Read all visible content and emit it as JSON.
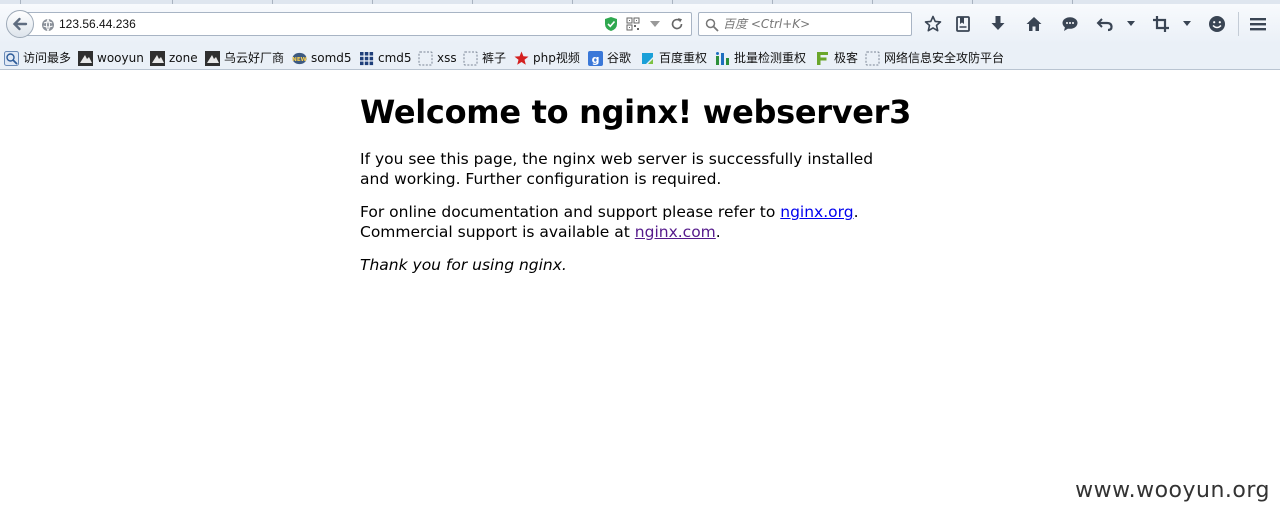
{
  "browser": {
    "url": "123.56.44.236",
    "search_placeholder": "百度 <Ctrl+K>",
    "bookmarks": [
      {
        "label": "访问最多",
        "icon": "most-visited-icon"
      },
      {
        "label": "wooyun",
        "icon": "wooyun-icon"
      },
      {
        "label": "zone",
        "icon": "zone-icon"
      },
      {
        "label": "乌云好厂商",
        "icon": "wooyun-vendor-icon"
      },
      {
        "label": "somd5",
        "icon": "somd5-icon"
      },
      {
        "label": "cmd5",
        "icon": "cmd5-icon"
      },
      {
        "label": "xss",
        "icon": "blank-page-icon"
      },
      {
        "label": "裤子",
        "icon": "blank-page-icon"
      },
      {
        "label": "php视频",
        "icon": "red-star-icon"
      },
      {
        "label": "谷歌",
        "icon": "google-icon"
      },
      {
        "label": "百度重权",
        "icon": "baidu-weight-icon"
      },
      {
        "label": "批量检测重权",
        "icon": "batch-check-icon"
      },
      {
        "label": "极客",
        "icon": "geek-icon"
      },
      {
        "label": "网络信息安全攻防平台",
        "icon": "blank-page-icon"
      }
    ]
  },
  "page": {
    "heading": "Welcome to nginx! webserver3",
    "para1": "If you see this page, the nginx web server is successfully installed and working. Further configuration is required.",
    "para2_prefix": "For online documentation and support please refer to ",
    "link_org": "nginx.org",
    "para2_mid": ".",
    "para2_line2_prefix": "Commercial support is available at ",
    "link_com": "nginx.com",
    "para2_suffix": ".",
    "thanks": "Thank you for using nginx."
  },
  "watermark": "www.wooyun.org"
}
